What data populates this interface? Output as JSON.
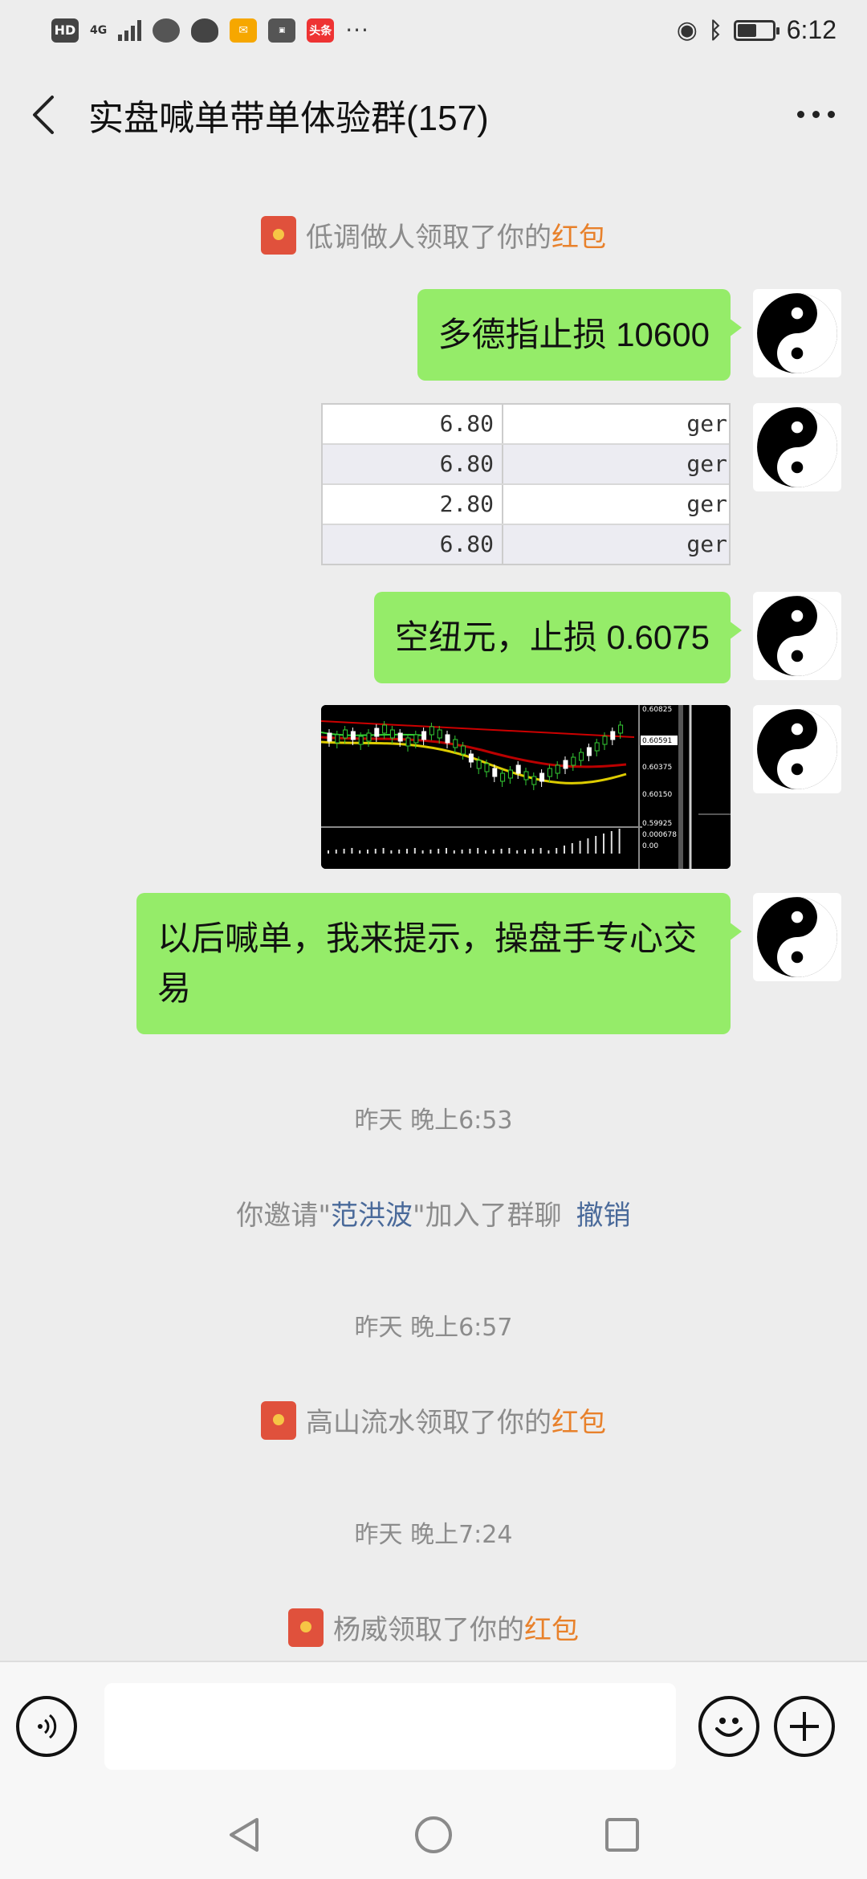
{
  "statusbar": {
    "hd": "HD",
    "network": "4G",
    "toutiao": "头条",
    "dots": "···",
    "time": "6:12",
    "battery_level": 0.55
  },
  "header": {
    "title": "实盘喊单带单体验群(157)"
  },
  "messages": {
    "sys1": {
      "name": "低调做人",
      "action": "领取了你的",
      "link": "红包"
    },
    "bubble1": "多德指止损 10600",
    "table": {
      "rows": [
        {
          "value": "6.80",
          "tag": "ger"
        },
        {
          "value": "6.80",
          "tag": "ger"
        },
        {
          "value": "2.80",
          "tag": "ger"
        },
        {
          "value": "6.80",
          "tag": "ger"
        }
      ]
    },
    "bubble2": "空纽元，止损 0.6075",
    "chart": {
      "price_labels": [
        "0.60825",
        "0.60591",
        "0.60375",
        "0.60150",
        "0.59925",
        "0.000678",
        "0.00"
      ]
    },
    "bubble3": "以后喊单，我来提示，操盘手专心交易",
    "time1": "昨天 晚上6:53",
    "invite": {
      "prefix": "你邀请\"",
      "name": "范洪波",
      "suffix": "\"加入了群聊",
      "revoke": "撤销"
    },
    "time2": "昨天 晚上6:57",
    "sys2": {
      "name": "高山流水",
      "action": "领取了你的",
      "link": "红包"
    },
    "time3": "昨天 晚上7:24",
    "sys3": {
      "name": "杨威",
      "action": "领取了你的",
      "link": "红包"
    }
  },
  "inputbar": {
    "value": ""
  }
}
